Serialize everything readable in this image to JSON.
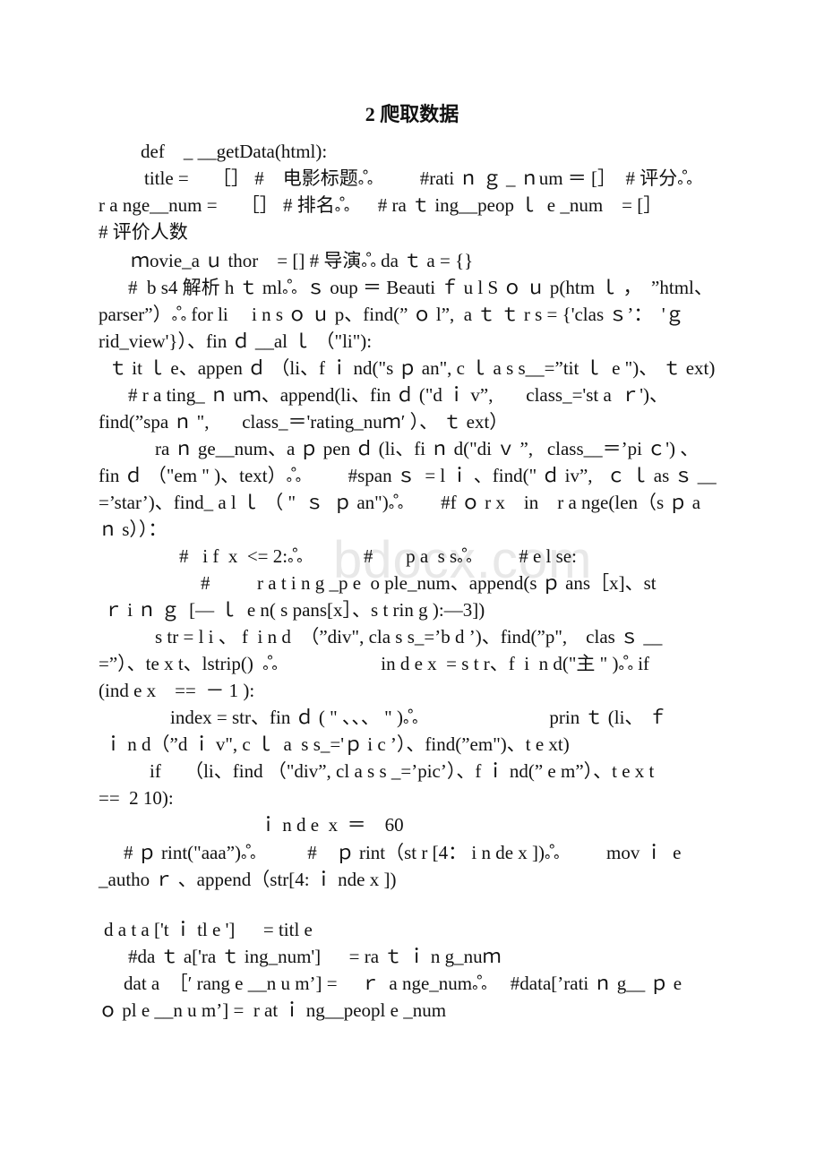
{
  "document": {
    "heading": "2 爬取数据",
    "watermark": "bdocx.com",
    "lines": [
      "def    _ __getData(html):",
      "title =     ［］ #    电影标题ஃ          #rati ｎ ｇ _ ｎum ＝ [］  # 评分ஃ",
      "r a nge__num =     ［］ # 排名ஃ      # ra ｔ ing__peop ｌ  e _num    = [］",
      "# 评价人数",
      "ｍovie_a ｕ thor    = [] # 导演ஃ da ｔ a = {}",
      "#  b s4 解析 h ｔ mlஃ  ｓ oup ＝ Beauti ｆ u l S ｏ ｕ p(htm ｌ ，  ”html、",
      "parser”）ஃ for li     i n s ｏ ｕ p、find(” ｏ l”,  a ｔ ｔ r s = {'clas ｓ’：  'ｇ",
      "rid_view'}）、fin ｄ __al ｌ （\"li\"):",
      "ｔ it ｌ e、appen ｄ （li、f ｉ nd(\"s ｐ an\", c ｌ a s s__=”tit ｌ  e \")、 ｔ ext)",
      "# r a ting_ ｎ uｍ、append(li、fin ｄ (\"d ｉ v”,       class_='st a  ｒ')、",
      "find(”spa ｎ \",       class_＝'rating_nuｍ′ ）、 ｔ ext）",
      "ra ｎ ge__num、a ｐ pen ｄ (li、fi ｎ d(\"di ｖ ”,   class__＝’pi ｃ') 、",
      "fin ｄ （\"em \" )、text）ஃ          #span ｓ  = l ｉ 、find(\" ｄ iv”,   ｃ ｌ as ｓ __",
      "=’star’)、find_ a l ｌ （ \"  ｓ  ｐ an\")ஃ        #f ｏ r x    in    r a nge(len（s ｐ a",
      "ｎ s））：",
      "#   i f  x  <= 2:ஃ             #       p a  s sஃ          # e l se:",
      "#          r a t i n g _p e  o ple_num、append(s ｐ ans［x]、st",
      "ｒ i ｎ ｇ  [— ｌ  e n( s pans[x］、s t rin g ):—3])",
      "s tr = l i 、 f  i n d  （”div\", cla s s_=’b d ’)、find(”p\",    clas ｓ __",
      "=”）、te x t、lstrip()  ஃ                      in d e x  = s t r、f  i  n d(\"主 \" )ஃ if",
      "(ind e x    ==  － 1 ):",
      "index = str、fin ｄ ( \" 、、、 \" )ஃ                            prin ｔ (li、 ｆ",
      "ｉ n d（”d ｉ v\", c ｌ  a  s s_='ｐ i c ’）、find(”em\")、t e xt)",
      "if     （li、find （\"div”, cl a s s _=’pic’）、f ｉ nd(” e m”）、t e x t",
      "==  2 10):",
      "ｉ n d e  x  ＝    60",
      "# ｐ rint(\"aaa”)ஃ           #    ｐ rint（st r [4： i n de x ])ஃ          mov ｉ  e",
      "_autho ｒ 、append（str[4: ｉ nde x ])",
      "d a t a ['t ｉ tl e ']      = titl e",
      "#da ｔ a['ra ｔ ing_num']      = ra ｔ ｉ n g_nuｍ",
      "dat a  ［′ rang e __n u m’] =     ｒ  a nge_numஃ     #data[’rati ｎ g__ ｐ e",
      "ｏ pl e __n u m’] =  r at ｉ ng__peopl e _num"
    ]
  }
}
